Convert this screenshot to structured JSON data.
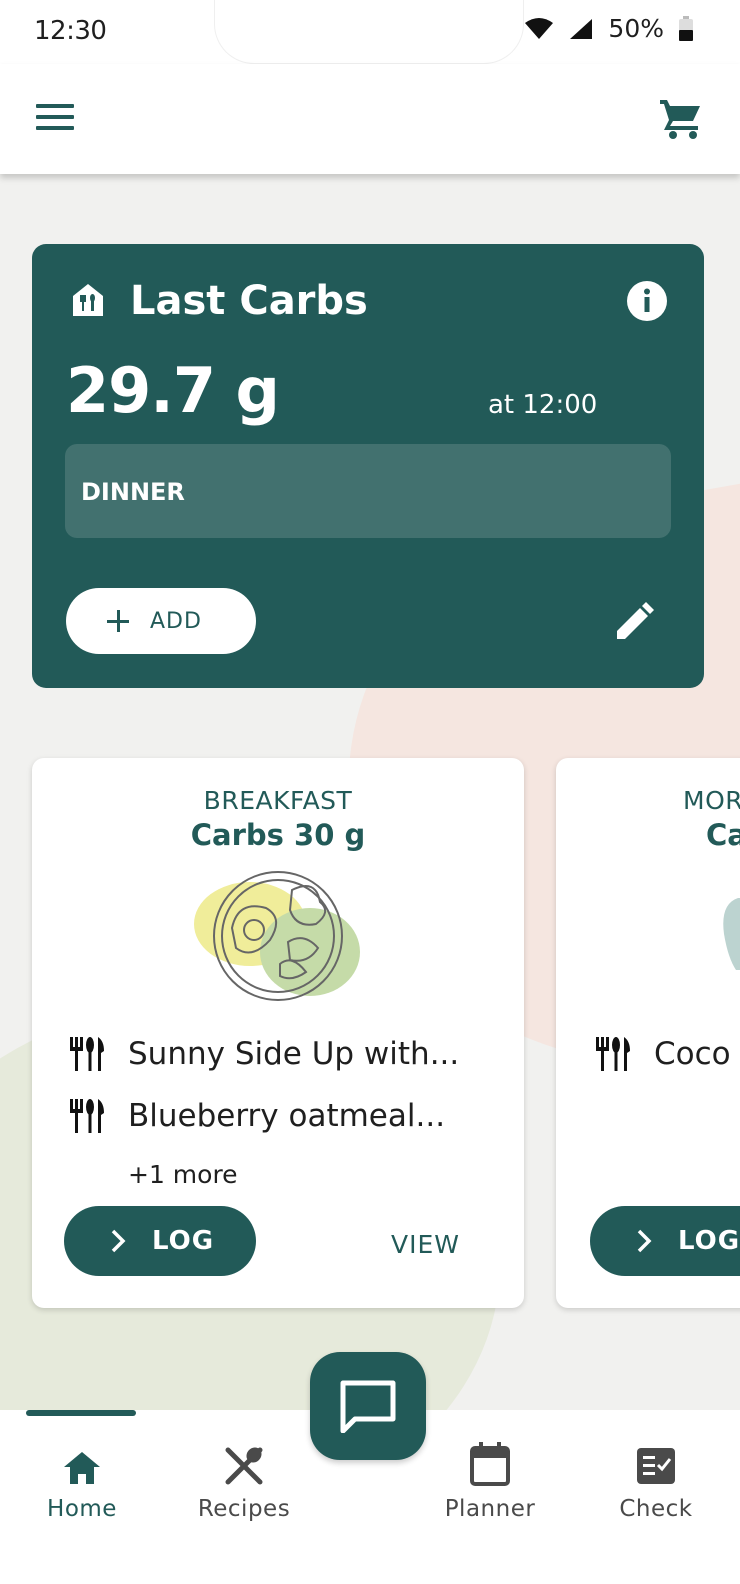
{
  "status_bar": {
    "time": "12:30",
    "battery": "50%"
  },
  "header": {
    "menu_icon": "menu-icon",
    "cart_icon": "cart-icon"
  },
  "last_carbs": {
    "title": "Last Carbs",
    "value": "29.7  g",
    "time": "at 12:00",
    "meal": "DINNER",
    "add_label": "ADD"
  },
  "meals": [
    {
      "type": "BREAKFAST",
      "carbs": "Carbs 30 g",
      "items": [
        "Sunny Side Up with...",
        "Blueberry oatmeal..."
      ],
      "more": "+1 more",
      "log_label": "LOG",
      "view_label": "VIEW"
    },
    {
      "type": "MOR",
      "carbs": "Ca",
      "items": [
        "Coco"
      ],
      "log_label": "LOG"
    }
  ],
  "bottom_nav": {
    "items": [
      {
        "label": "Home",
        "icon": "home-icon",
        "active": true
      },
      {
        "label": "Recipes",
        "icon": "recipes-icon",
        "active": false
      },
      {
        "label": "Planner",
        "icon": "calendar-icon",
        "active": false
      },
      {
        "label": "Check",
        "icon": "checklist-icon",
        "active": false
      }
    ]
  },
  "colors": {
    "primary": "#225a58",
    "primary_light": "#42716f",
    "background": "#f1f1ef"
  }
}
